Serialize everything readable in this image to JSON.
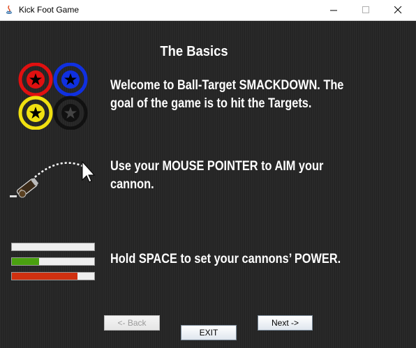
{
  "window": {
    "title": "Kick Foot Game",
    "icons": [
      "java-app-icon",
      "minimize-icon",
      "maximize-icon",
      "close-icon"
    ]
  },
  "page": {
    "heading": "The Basics",
    "paragraphs": [
      [
        "Welcome to Ball-Target SMACKDOWN. The",
        "goal of the game is to hit the Targets."
      ],
      [
        "Use your MOUSE POINTER to AIM your",
        "cannon."
      ],
      [
        "Hold SPACE to set your cannons’ POWER."
      ]
    ],
    "target_colors": [
      "#e01010",
      "#1030e0",
      "#f0e010",
      "#111111"
    ],
    "power_bars": [
      {
        "level": 0.0,
        "color": "#eeeeee"
      },
      {
        "level": 0.33,
        "color": "#4aa010"
      },
      {
        "level": 0.8,
        "color": "#d03010"
      }
    ]
  },
  "buttons": {
    "back": "<- Back",
    "next": "Next ->",
    "exit": "EXIT"
  }
}
